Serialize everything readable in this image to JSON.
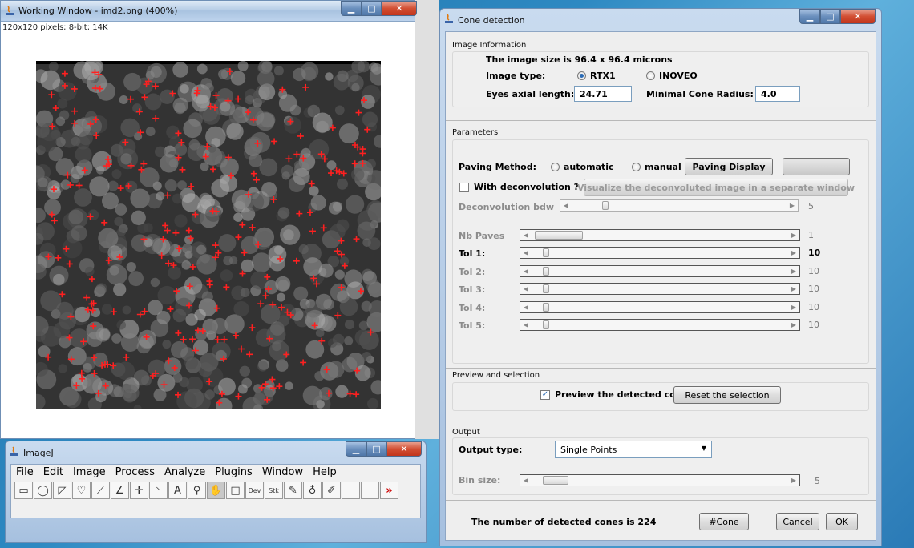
{
  "working_window": {
    "title": "Working Window - imd2.png (400%)",
    "info": "120x120 pixels; 8-bit; 14K"
  },
  "imagej": {
    "title": "ImageJ",
    "menu": [
      "File",
      "Edit",
      "Image",
      "Process",
      "Analyze",
      "Plugins",
      "Window",
      "Help"
    ],
    "tools": [
      {
        "name": "rectangle-tool-icon",
        "glyph": "▭"
      },
      {
        "name": "oval-tool-icon",
        "glyph": "◯"
      },
      {
        "name": "polygon-tool-icon",
        "glyph": "◸"
      },
      {
        "name": "freehand-tool-icon",
        "glyph": "♡"
      },
      {
        "name": "line-tool-icon",
        "glyph": "⟋"
      },
      {
        "name": "angle-tool-icon",
        "glyph": "∠"
      },
      {
        "name": "point-tool-icon",
        "glyph": "✛"
      },
      {
        "name": "wand-tool-icon",
        "glyph": "⸌"
      },
      {
        "name": "text-tool-icon",
        "glyph": "A"
      },
      {
        "name": "magnifier-tool-icon",
        "glyph": "⚲"
      },
      {
        "name": "hand-tool-icon",
        "glyph": "✋"
      },
      {
        "name": "color-picker-tool-icon",
        "glyph": "□"
      },
      {
        "name": "dev-tool-icon",
        "glyph": "Dev"
      },
      {
        "name": "stk-tool-icon",
        "glyph": "Stk"
      },
      {
        "name": "brush-tool-icon",
        "glyph": "✎"
      },
      {
        "name": "flood-fill-tool-icon",
        "glyph": "♁"
      },
      {
        "name": "pencil-tool-icon",
        "glyph": "✐"
      },
      {
        "name": "empty-tool-slot",
        "glyph": ""
      },
      {
        "name": "empty-tool-slot",
        "glyph": ""
      },
      {
        "name": "more-tools-icon",
        "glyph": "»"
      }
    ]
  },
  "cone": {
    "title": "Cone detection",
    "image_info": {
      "section": "Image Information",
      "size_text": "The image size is 96.4 x 96.4 microns",
      "type_label": "Image type:",
      "type_options": [
        "RTX1",
        "INOVEO"
      ],
      "axial_label": "Eyes axial length:",
      "axial_value": "24.71",
      "radius_label": "Minimal Cone Radius:",
      "radius_value": "4.0"
    },
    "parameters": {
      "section": "Parameters",
      "paving_label": "Paving Method:",
      "paving_options": [
        "automatic",
        "manual"
      ],
      "paving_display_btn": "Paving Display",
      "deconv_label": "With deconvolution ?",
      "visualize_btn": "Visualize the deconvoluted image in a separate window",
      "deconv_bdw_label": "Deconvolution bdw",
      "deconv_bdw_value": "5",
      "sliders": [
        {
          "label": "Nb Paves",
          "value": "1"
        },
        {
          "label": "Tol 1:",
          "value": "10"
        },
        {
          "label": "Tol 2:",
          "value": "10"
        },
        {
          "label": "Tol 3:",
          "value": "10"
        },
        {
          "label": "Tol 4:",
          "value": "10"
        },
        {
          "label": "Tol 5:",
          "value": "10"
        }
      ]
    },
    "preview": {
      "section": "Preview and selection",
      "preview_label": "Preview the detected cones",
      "reset_btn": "Reset the selection"
    },
    "output": {
      "section": "Output",
      "type_label": "Output type:",
      "type_value": "Single Points",
      "bin_label": "Bin size:",
      "bin_value": "5"
    },
    "footer": {
      "count_text": "The number of detected cones is 224",
      "cone_btn": "#Cone",
      "cancel_btn": "Cancel",
      "ok_btn": "OK"
    }
  },
  "colors": {
    "marker": "#ff2020",
    "accent": "#2b6bb5"
  }
}
